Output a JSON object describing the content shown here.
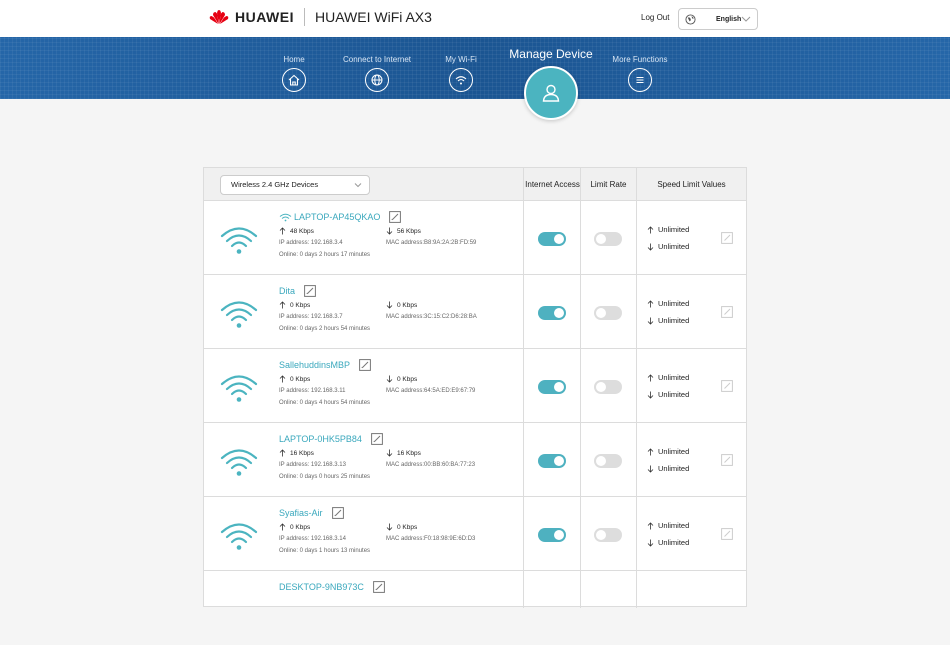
{
  "header": {
    "brand": "HUAWEI",
    "product": "HUAWEI WiFi AX3",
    "logout": "Log Out",
    "language": "English"
  },
  "nav": {
    "items": [
      {
        "label": "Home",
        "icon": "home-icon"
      },
      {
        "label": "Connect to Internet",
        "icon": "globe-icon"
      },
      {
        "label": "My Wi-Fi",
        "icon": "wifi-icon"
      },
      {
        "label": "More Functions",
        "icon": "menu-icon"
      }
    ],
    "active": {
      "label": "Manage Device",
      "icon": "user-icon"
    }
  },
  "table": {
    "band_select": "Wireless 2.4 GHz Devices",
    "headers": {
      "internet_access": "Internet Access",
      "limit_rate": "Limit Rate",
      "speed_limit": "Speed Limit Values"
    },
    "rows": [
      {
        "name": "LAPTOP-AP45QKAO",
        "connected_icon": true,
        "up": "48 Kbps",
        "down": "56 Kbps",
        "ip": "IP address: 192.168.3.4",
        "mac": "MAC address:B8:9A:2A:2B:FD:59",
        "online": "Online: 0 days 2 hours 17 minutes",
        "internet_access": true,
        "limit_rate": false,
        "up_limit": "Unlimited",
        "down_limit": "Unlimited"
      },
      {
        "name": "Dita",
        "connected_icon": false,
        "up": "0 Kbps",
        "down": "0 Kbps",
        "ip": "IP address: 192.168.3.7",
        "mac": "MAC address:3C:15:C2:D6:28:BA",
        "online": "Online: 0 days 2 hours 54 minutes",
        "internet_access": true,
        "limit_rate": false,
        "up_limit": "Unlimited",
        "down_limit": "Unlimited"
      },
      {
        "name": "SallehuddinsMBP",
        "connected_icon": false,
        "up": "0 Kbps",
        "down": "0 Kbps",
        "ip": "IP address: 192.168.3.11",
        "mac": "MAC address:64:5A:ED:E9:67:79",
        "online": "Online: 0 days 4 hours 54 minutes",
        "internet_access": true,
        "limit_rate": false,
        "up_limit": "Unlimited",
        "down_limit": "Unlimited"
      },
      {
        "name": "LAPTOP-0HK5PB84",
        "connected_icon": false,
        "up": "16 Kbps",
        "down": "16 Kbps",
        "ip": "IP address: 192.168.3.13",
        "mac": "MAC address:00:BB:60:BA:77:23",
        "online": "Online: 0 days 0 hours 25 minutes",
        "internet_access": true,
        "limit_rate": false,
        "up_limit": "Unlimited",
        "down_limit": "Unlimited"
      },
      {
        "name": "Syafias-Air",
        "connected_icon": false,
        "up": "0 Kbps",
        "down": "0 Kbps",
        "ip": "IP address: 192.168.3.14",
        "mac": "MAC address:F0:18:98:9E:6D:D3",
        "online": "Online: 0 days 1 hours 13 minutes",
        "internet_access": true,
        "limit_rate": false,
        "up_limit": "Unlimited",
        "down_limit": "Unlimited"
      },
      {
        "name": "DESKTOP-9NB973C",
        "connected_icon": false,
        "up": "",
        "down": "",
        "ip": "",
        "mac": "",
        "online": "",
        "internet_access": null,
        "limit_rate": null,
        "up_limit": "",
        "down_limit": ""
      }
    ]
  },
  "colors": {
    "accent": "#4bb4c0",
    "nav_band": "#1d5a99",
    "link": "#3aa8bd"
  }
}
